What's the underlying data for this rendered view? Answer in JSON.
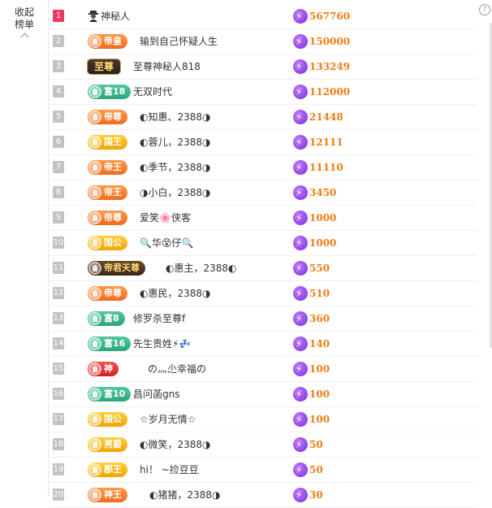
{
  "sidebar": {
    "collapse_line1": "收起",
    "collapse_line2": "榜单",
    "help": "?"
  },
  "rows": [
    {
      "rank": "1",
      "badge": "",
      "name": "神秘人",
      "score": "567760"
    },
    {
      "rank": "2",
      "badge": "帝皇",
      "name": "输到自己怀疑人生",
      "score": "150000"
    },
    {
      "rank": "3",
      "badge": "至尊",
      "name": "至尊神秘人818",
      "score": "133249"
    },
    {
      "rank": "4",
      "badge": "富18",
      "name": "无双时代",
      "score": "112000"
    },
    {
      "rank": "5",
      "badge": "帝尊",
      "name": "◐知惠、2388◑",
      "score": "21448"
    },
    {
      "rank": "6",
      "badge": "国王",
      "name": "◐蓉儿，2388◑",
      "score": "12111"
    },
    {
      "rank": "7",
      "badge": "帝王",
      "name": "◐季节，2388◑",
      "score": "11110"
    },
    {
      "rank": "8",
      "badge": "帝王",
      "name": "◑小白，2388◑",
      "score": "3450"
    },
    {
      "rank": "9",
      "badge": "帝尊",
      "name": "爱笑🌸侠客",
      "score": "1000"
    },
    {
      "rank": "10",
      "badge": "国公",
      "name": "🔍华😵仔🔍",
      "score": "1000"
    },
    {
      "rank": "11",
      "badge": "帝君天尊",
      "name": "◐惠主，2388◐",
      "score": "550"
    },
    {
      "rank": "12",
      "badge": "帝尊",
      "name": "◐惠民，2388◑",
      "score": "510"
    },
    {
      "rank": "13",
      "badge": "富8",
      "name": "修罗杀至尊f",
      "score": "360"
    },
    {
      "rank": "14",
      "badge": "富16",
      "name": "先生贵姓⚡💤",
      "score": "140"
    },
    {
      "rank": "15",
      "badge": "神",
      "name": "の灬尐幸福の",
      "score": "100"
    },
    {
      "rank": "16",
      "badge": "富10",
      "name": "昌问菡gns",
      "score": "100"
    },
    {
      "rank": "17",
      "badge": "国公",
      "name": "☆岁月无情☆",
      "score": "100"
    },
    {
      "rank": "18",
      "badge": "男爵",
      "name": "◐微笑，2388◑",
      "score": "50"
    },
    {
      "rank": "19",
      "badge": "郡王",
      "name": "hi！ ~捡豆豆",
      "score": "50"
    },
    {
      "rank": "20",
      "badge": "神王",
      "name": "◐猪猪，2388◑",
      "score": "30"
    }
  ]
}
